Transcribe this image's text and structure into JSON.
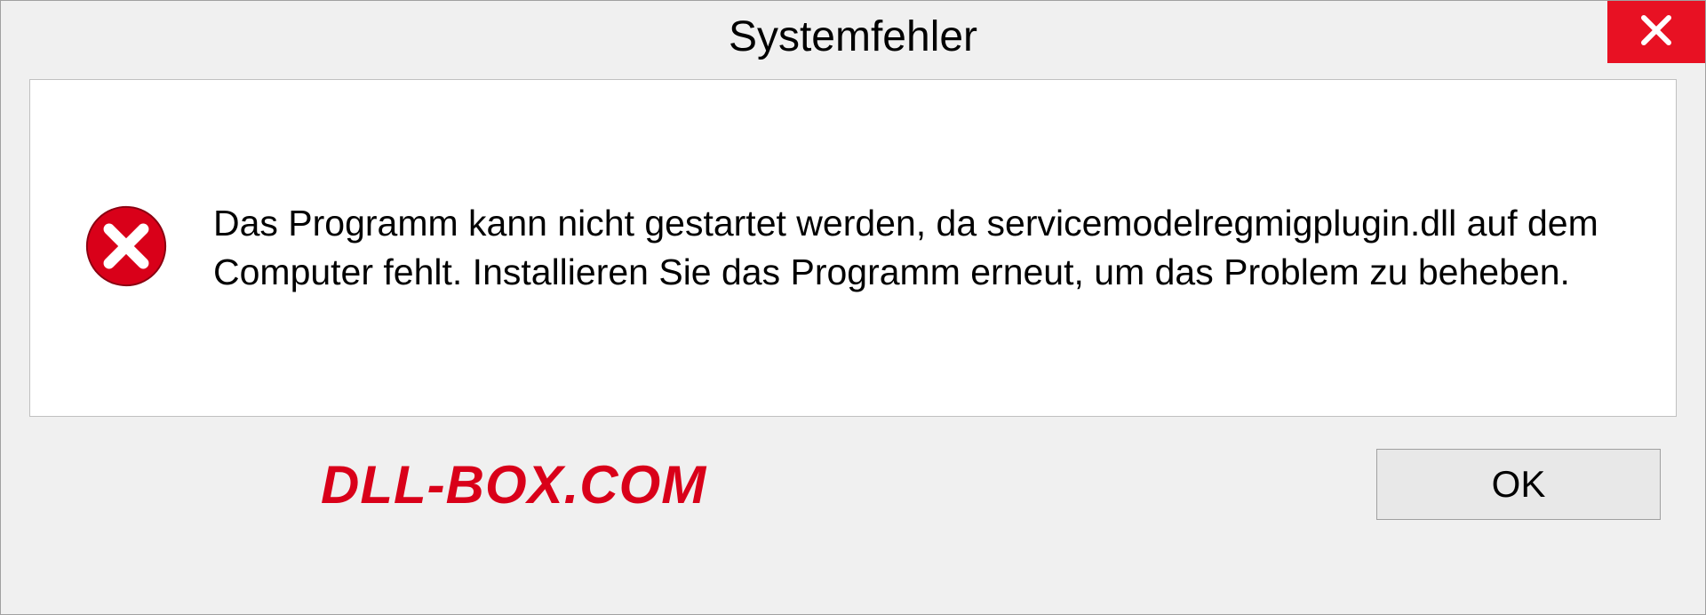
{
  "dialog": {
    "title": "Systemfehler",
    "message": "Das Programm kann nicht gestartet werden, da servicemodelregmigplugin.dll auf dem Computer fehlt. Installieren Sie das Programm erneut, um das Problem zu beheben.",
    "ok_label": "OK"
  },
  "brand": {
    "text": "DLL-BOX.COM"
  },
  "colors": {
    "close_bg": "#e81123",
    "error_icon": "#d90019",
    "brand": "#d90019"
  }
}
